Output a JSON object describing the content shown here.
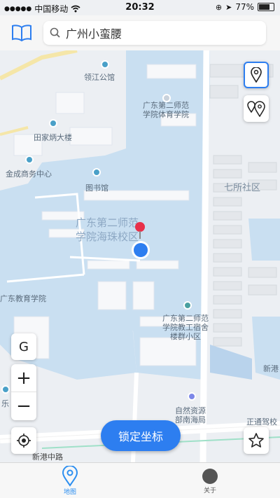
{
  "status": {
    "carrier": "中国移动",
    "time": "20:32",
    "battery": "77%",
    "battery_level": 0.77
  },
  "search": {
    "value": "广州小蛮腰",
    "placeholder": "搜索"
  },
  "map": {
    "labels": {
      "lingjiang": "领江公馆",
      "pe_school": "广东第二师范\n学院体育学院",
      "tianjia": "田家炳大楼",
      "jincheng": "金成商务中心",
      "library": "图书馆",
      "qisuo": "七所社区",
      "campus": "广东第二师范\n学院海珠校区",
      "edu_school": "广东教育学院",
      "staff_quarters": "广东第二师范\n学院教工宿舍\n楼群小区",
      "xingang_right": "新港",
      "natural_res": "自然资源\n部南海局",
      "zhengtong": "正通驾校",
      "xingang_road": "新港中路",
      "left_edge": "乐"
    }
  },
  "controls": {
    "google": "G",
    "zoom_in": "+",
    "zoom_out": "−"
  },
  "lock_button": "锁定坐标",
  "tabs": [
    {
      "label": "地图",
      "color": "#2d8ff0"
    },
    {
      "label": "关于",
      "color": "#555555"
    }
  ],
  "colors": {
    "accent": "#2d7ef0",
    "campus_fill": "#c9dff1",
    "land": "#eceff3"
  }
}
